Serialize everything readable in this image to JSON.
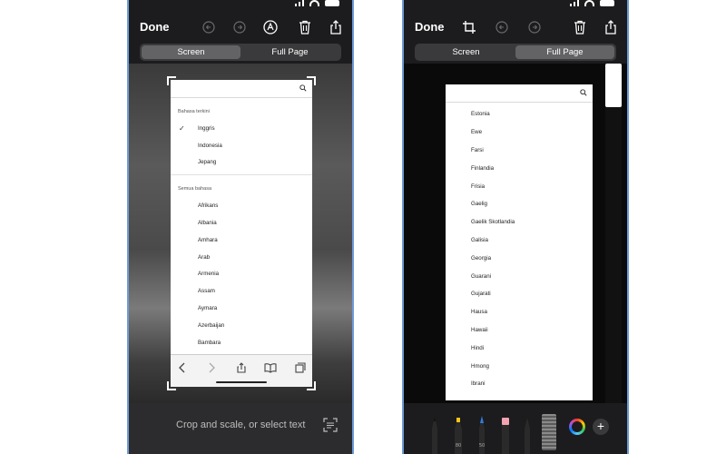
{
  "left": {
    "toolbar": {
      "done_label": "Done"
    },
    "segments": {
      "screen": "Screen",
      "full_page": "Full Page",
      "active": "screen"
    },
    "recent_header": "Bahasa terkini",
    "recent_langs": [
      {
        "label": "Inggris",
        "checked": true
      },
      {
        "label": "Indonesia",
        "checked": false
      },
      {
        "label": "Jepang",
        "checked": false
      }
    ],
    "all_header": "Semua bahasa",
    "all_langs": [
      "Afrikans",
      "Albania",
      "Amhara",
      "Arab",
      "Armenia",
      "Assam",
      "Aymara",
      "Azerbaijan",
      "Bambara"
    ],
    "crop_hint": "Crop and scale, or select text"
  },
  "right": {
    "toolbar": {
      "done_label": "Done"
    },
    "segments": {
      "screen": "Screen",
      "full_page": "Full Page",
      "active": "full_page"
    },
    "langs": [
      "Estonia",
      "Ewe",
      "Farsi",
      "Finlandia",
      "Frisia",
      "Gaelig",
      "Gaelik Skotlandia",
      "Galisia",
      "Georgia",
      "Guarani",
      "Gujarati",
      "Hausa",
      "Hawaii",
      "Hindi",
      "Hmong",
      "Ibrani"
    ]
  },
  "colors": {
    "pen_yellow": "#f5c518",
    "pen_blue": "#2f7de1",
    "pen_pink": "#f4a3b0",
    "frame_blue": "#6e9bd8"
  },
  "icons": [
    "undo-icon",
    "redo-icon",
    "markup-icon",
    "trash-icon",
    "share-icon",
    "crop-icon",
    "search-icon",
    "live-text-icon",
    "color-wheel-icon",
    "add-icon"
  ]
}
